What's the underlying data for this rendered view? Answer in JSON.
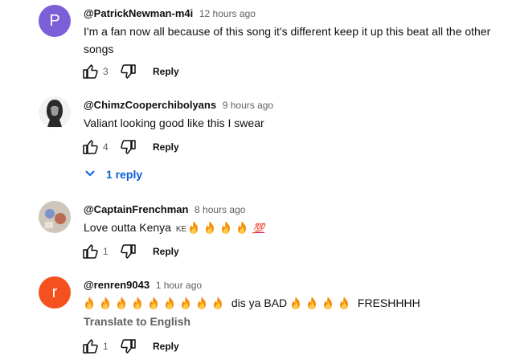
{
  "comments": [
    {
      "handle": "@PatrickNewman-m4i",
      "time": "12 hours ago",
      "avatar_letter": "P",
      "avatar_color": "#7b5fd6",
      "text": "I'm a fan now all because of this song it's different keep it up this beat all the other songs",
      "likes": "3",
      "reply_label": "Reply"
    },
    {
      "handle": "@ChimzCooperchibolyans",
      "time": "9 hours ago",
      "text": "Valiant looking good like this I swear",
      "likes": "4",
      "reply_label": "Reply",
      "replies_label": "1 reply"
    },
    {
      "handle": "@CaptainFrenchman",
      "time": "8 hours ago",
      "text_prefix": "Love outta Kenya",
      "flag_text": "KE",
      "hundred": "💯",
      "likes": "1",
      "reply_label": "Reply"
    },
    {
      "handle": "@renren9043",
      "time": "1 hour ago",
      "avatar_letter": "r",
      "avatar_color": "#f4511e",
      "text_mid": "dis ya BAD",
      "text_end": "FRESHHHH",
      "translate_label": "Translate to English",
      "likes": "1",
      "reply_label": "Reply"
    }
  ],
  "icons": {
    "like": "thumb-up-icon",
    "dislike": "thumb-down-icon",
    "fire": "fire-emoji",
    "chevron": "chevron-down-icon"
  }
}
